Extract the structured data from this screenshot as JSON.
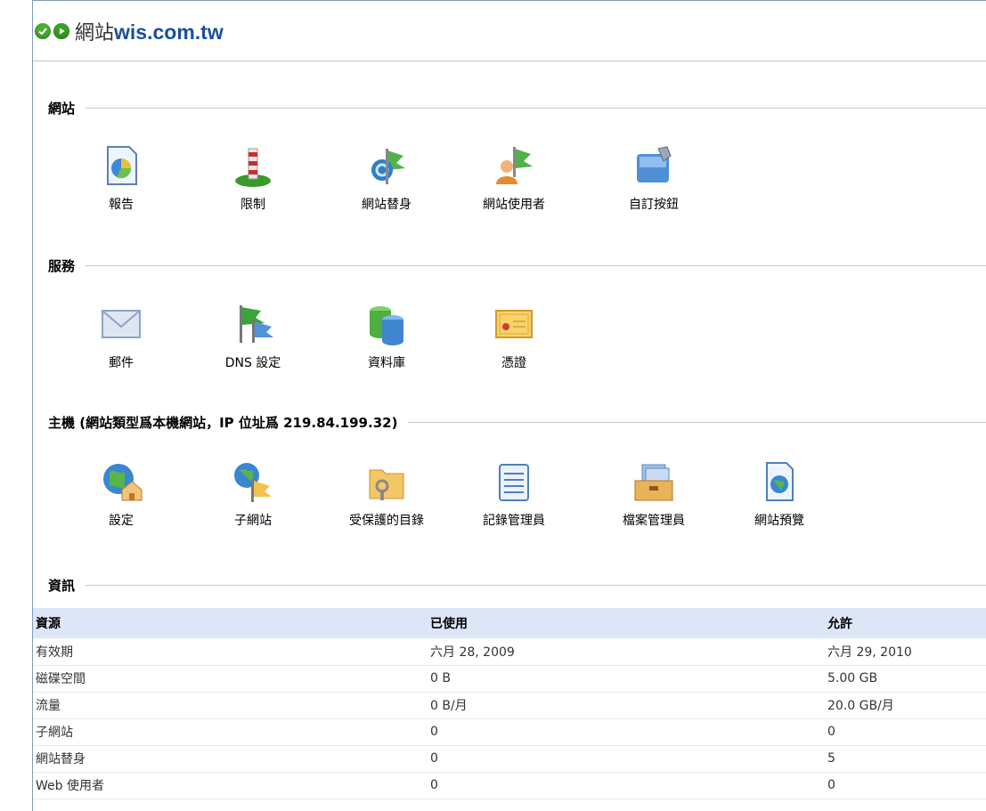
{
  "header": {
    "title_prefix": "網站",
    "title_domain": "wis.com.tw"
  },
  "sections": {
    "site": {
      "label": "網站",
      "items": [
        {
          "label": "報告",
          "icon": "report-icon"
        },
        {
          "label": "限制",
          "icon": "limits-icon"
        },
        {
          "label": "網站替身",
          "icon": "site-alias-icon"
        },
        {
          "label": "網站使用者",
          "icon": "site-users-icon"
        },
        {
          "label": "自訂按鈕",
          "icon": "custom-buttons-icon"
        }
      ]
    },
    "services": {
      "label": "服務",
      "items": [
        {
          "label": "郵件",
          "icon": "mail-icon"
        },
        {
          "label": "DNS 設定",
          "icon": "dns-icon"
        },
        {
          "label": "資料庫",
          "icon": "database-icon"
        },
        {
          "label": "憑證",
          "icon": "certificate-icon"
        }
      ]
    },
    "host": {
      "label": "主機 (網站類型爲本機網站，IP 位址爲 219.84.199.32)",
      "items": [
        {
          "label": "設定",
          "icon": "settings-icon"
        },
        {
          "label": "子網站",
          "icon": "subdomains-icon"
        },
        {
          "label": "受保護的目錄",
          "icon": "protected-dir-icon"
        },
        {
          "label": "記錄管理員",
          "icon": "log-manager-icon"
        },
        {
          "label": "檔案管理員",
          "icon": "file-manager-icon"
        },
        {
          "label": "網站預覽",
          "icon": "site-preview-icon"
        }
      ]
    },
    "info": {
      "label": "資訊"
    }
  },
  "table": {
    "headers": [
      "資源",
      "已使用",
      "允許"
    ],
    "rows": [
      [
        "有效期",
        "六月 28, 2009",
        "六月 29, 2010"
      ],
      [
        "磁碟空間",
        "0 B",
        "5.00 GB"
      ],
      [
        "流量",
        "0 B/月",
        "20.0 GB/月"
      ],
      [
        "子網站",
        "0",
        "0"
      ],
      [
        "網站替身",
        "0",
        "5"
      ],
      [
        "Web 使用者",
        "0",
        "0"
      ]
    ]
  },
  "colors": {
    "table_header_bg": "#dde6f7",
    "domain_text": "#1b4f9c",
    "status_green": "#4caf32"
  }
}
